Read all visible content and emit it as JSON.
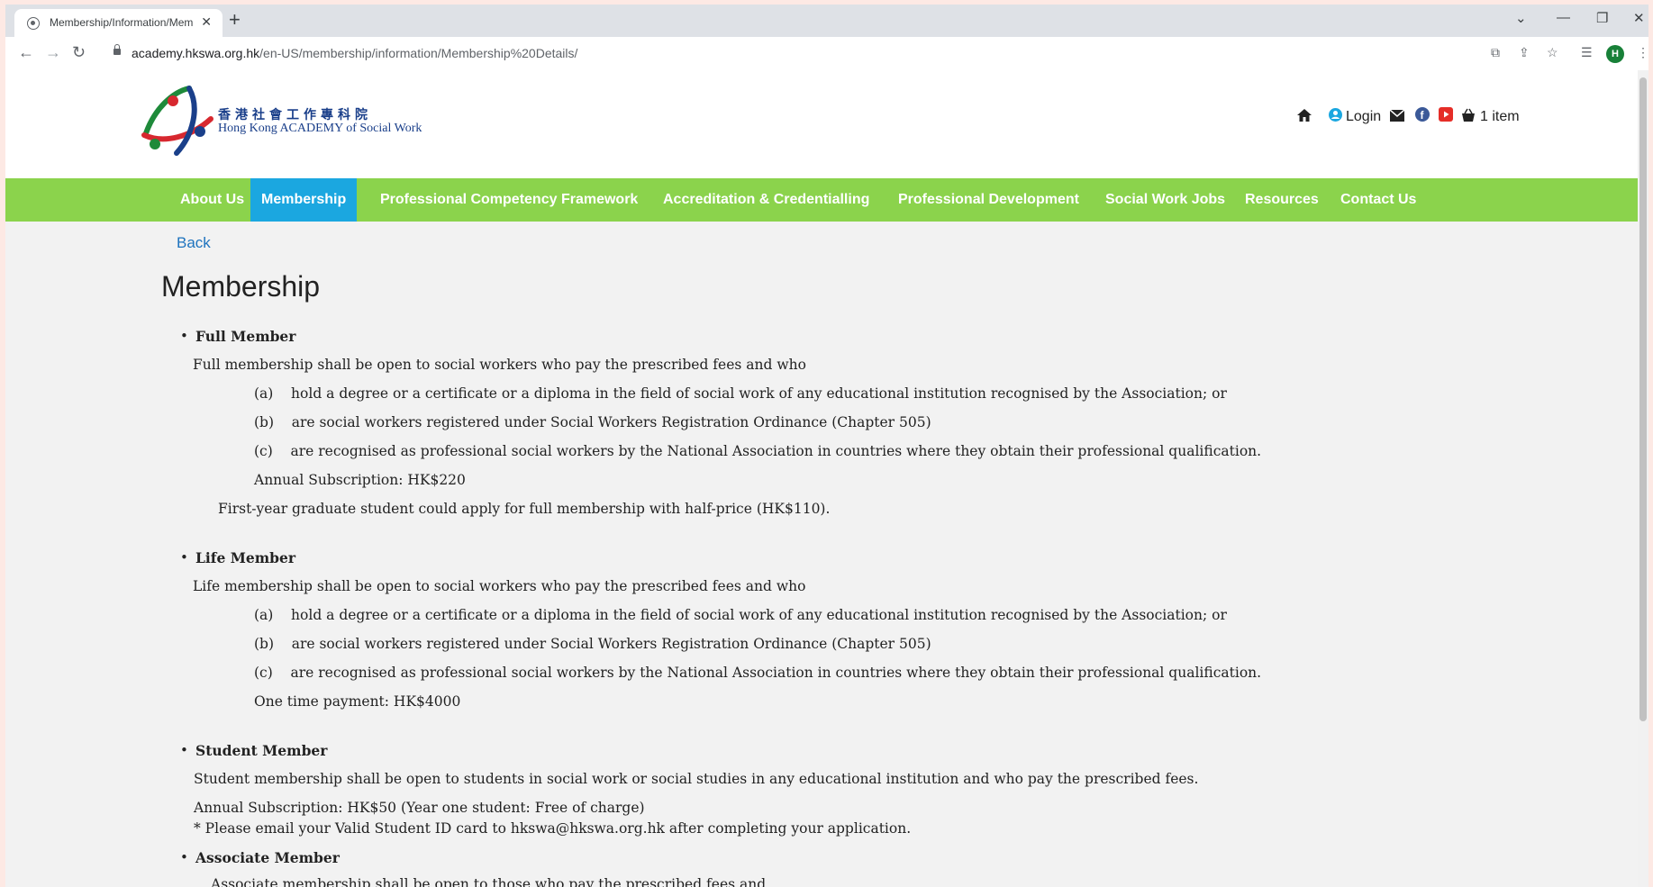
{
  "browser": {
    "tab_title": "Membership/Information/Mem",
    "url_host": "academy.hkswa.org.hk",
    "url_path": "/en-US/membership/information/Membership%20Details/",
    "profile_initial": "H"
  },
  "site": {
    "logo_zh": "香港社會工作專科院",
    "logo_en": "Hong Kong ACADEMY of Social Work",
    "login": "Login",
    "cart": "1 item"
  },
  "nav": {
    "items": [
      {
        "label": "About Us"
      },
      {
        "label": "Membership"
      },
      {
        "label": "Professional Competency Framework"
      },
      {
        "label": "Accreditation & Credentialling"
      },
      {
        "label": "Professional Development"
      },
      {
        "label": "Social Work Jobs"
      },
      {
        "label": "Resources"
      },
      {
        "label": "Contact Us"
      }
    ],
    "active": "Membership"
  },
  "content": {
    "back": "Back",
    "title": "Membership",
    "full": {
      "heading": "Full Member",
      "intro": "Full membership shall be open to social workers who pay the prescribed fees and who",
      "a": "(a)    hold a degree or a certificate or a diploma in the field of social work of any educational institution recognised by the Association; or",
      "b": "(b)    are social workers registered under Social Workers Registration Ordinance (Chapter 505)",
      "c": "(c)    are recognised as professional social workers by the National Association in countries where they obtain their professional qualification.",
      "fee": "Annual Subscription: HK$220",
      "note": "First-year graduate student could apply for full membership with half-price (HK$110)."
    },
    "life": {
      "heading": "Life Member",
      "intro": "Life membership shall be open to social workers who pay the prescribed fees and who",
      "a": "(a)    hold a degree or a certificate or a diploma in the field of social work of any educational institution recognised by the Association; or",
      "b": "(b)    are social workers registered under Social Workers Registration Ordinance (Chapter 505)",
      "c": "(c)    are recognised as professional social workers by the National Association in countries where they obtain their professional qualification.",
      "fee": "One time payment: HK$4000"
    },
    "student": {
      "heading": "Student Member",
      "intro": "Student membership shall be open to students in social work or social studies in any educational institution and who pay the prescribed fees.",
      "fee": "Annual Subscription: HK$50 (Year one student: Free of charge)",
      "note": "* Please email your Valid Student ID card to hkswa@hkswa.org.hk after completing your application."
    },
    "associate": {
      "heading": "Associate Member",
      "intro": "Associate membership shall be open to those who pay the prescribed fees and"
    }
  }
}
